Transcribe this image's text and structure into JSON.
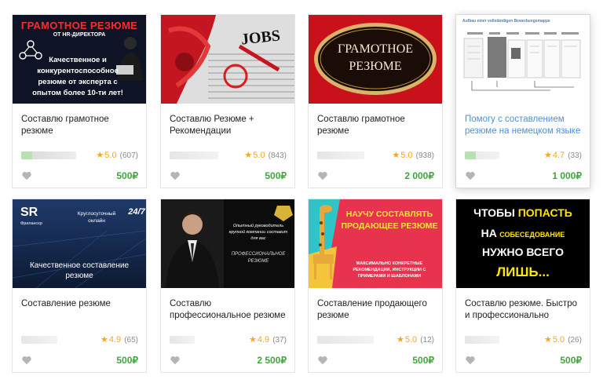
{
  "cards": [
    {
      "title": "Составлю грамотное резюме",
      "rating": "5.0",
      "reviews": "(607)",
      "price": "500₽",
      "thumb": {
        "headline": "ГРАМОТНОЕ РЕЗЮМЕ",
        "sub": "ОТ HR-ДИРЕКТОРА",
        "body": "Качественное и конкурентоспособное резюме от эксперта с опытом более 10-ти лет!"
      }
    },
    {
      "title": "Составлю Резюме + Рекомендации",
      "rating": "5.0",
      "reviews": "(843)",
      "price": "500₽",
      "thumb": {
        "headline": "JOBS"
      }
    },
    {
      "title": "Составлю грамотное резюме",
      "rating": "5.0",
      "reviews": "(938)",
      "price": "2 000₽",
      "thumb": {
        "headline": "ГРАМОТНОЕ РЕЗЮМЕ"
      }
    },
    {
      "title": "Помогу с составлением резюме на немецком языке",
      "rating": "4.7",
      "reviews": "(33)",
      "price": "1 000₽",
      "thumb": {
        "headline": "Aufbau einer vollständigen Bewerbungsmappe"
      }
    },
    {
      "title": "Составление резюме",
      "rating": "4.9",
      "reviews": "(65)",
      "price": "500₽",
      "thumb": {
        "logo": "SR",
        "logo_sub": "Фрилансер",
        "badge": "24/7",
        "line1": "Круглосуточный онлайн",
        "headline": "Качественное составление резюме"
      }
    },
    {
      "title": "Составлю профессиональное резюме",
      "rating": "4.9",
      "reviews": "(37)",
      "price": "2 500₽",
      "thumb": {
        "body": "Опытный руководитель крупной компании составит для вас",
        "headline": "ПРОФЕССИОНАЛЬНОЕ РЕЗЮМЕ"
      }
    },
    {
      "title": "Составление продающего резюме",
      "rating": "5.0",
      "reviews": "(12)",
      "price": "500₽",
      "thumb": {
        "headline": "НАУЧУ СОСТАВЛЯТЬ ПРОДАЮЩЕЕ РЕЗЮМЕ",
        "body": "МАКСИМАЛЬНО КОНКРЕТНЫЕ РЕКОМЕНДАЦИИ, ИНСТРУКЦИИ С ПРИМЕРАМИ И ШАБЛОНАМИ"
      }
    },
    {
      "title": "Составлю резюме. Быстро и профессионально",
      "rating": "5.0",
      "reviews": "(26)",
      "price": "500₽",
      "thumb": {
        "line1a": "ЧТОБЫ",
        "line1b": "ПОПАСТЬ",
        "line2a": "НА",
        "line2b": "СОБЕСЕДОВАНИЕ",
        "line3": "НУЖНО ВСЕГО",
        "line4": "ЛИШЬ..."
      }
    }
  ],
  "colors": {
    "price": "#41a53e",
    "star": "#f5a623",
    "link": "#4a90d9"
  }
}
